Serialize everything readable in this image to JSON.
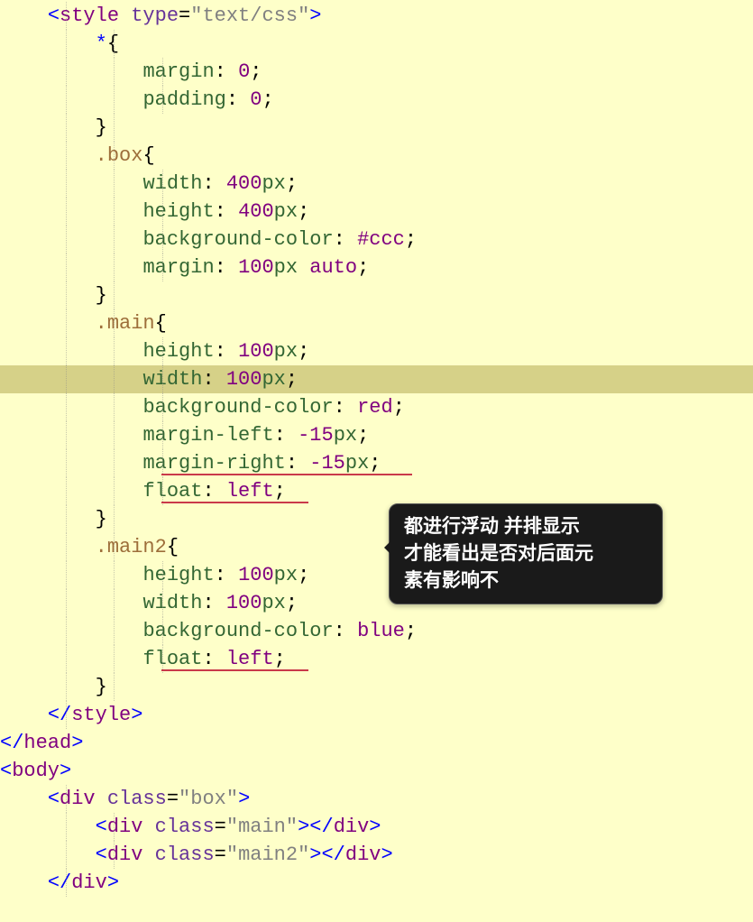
{
  "code": {
    "line1": {
      "lt": "<",
      "tag": "style",
      "sp": " ",
      "attr": "type",
      "eq": "=",
      "q1": "\"",
      "val": "text/css",
      "q2": "\"",
      "gt": ">"
    },
    "line2": {
      "sel": "*",
      "ob": "{"
    },
    "line3": {
      "prop": "margin",
      "c": ":",
      "sp": " ",
      "val": "0",
      "sc": ";"
    },
    "line4": {
      "prop": "padding",
      "c": ":",
      "sp": " ",
      "val": "0",
      "sc": ";"
    },
    "line5": {
      "cb": "}"
    },
    "line6": {
      "sel": ".box",
      "ob": "{"
    },
    "line7": {
      "prop": "width",
      "c": ":",
      "sp": " ",
      "val": "400",
      "unit": "px",
      "sc": ";"
    },
    "line8": {
      "prop": "height",
      "c": ":",
      "sp": " ",
      "val": "400",
      "unit": "px",
      "sc": ";"
    },
    "line9": {
      "prop": "background-color",
      "c": ":",
      "sp": " ",
      "val": "#ccc",
      "sc": ";"
    },
    "line10": {
      "prop": "margin",
      "c": ":",
      "sp": " ",
      "val": "100",
      "unit": "px",
      "sp2": " ",
      "val2": "auto",
      "sc": ";"
    },
    "line11": {
      "cb": "}"
    },
    "line12": {
      "sel": ".main",
      "ob": "{"
    },
    "line13": {
      "prop": "height",
      "c": ":",
      "sp": " ",
      "val": "100",
      "unit": "px",
      "sc": ";"
    },
    "line14": {
      "prop": "width",
      "c": ":",
      "sp": " ",
      "val": "100",
      "unit": "px",
      "sc": ";"
    },
    "line15": {
      "prop": "background-color",
      "c": ":",
      "sp": " ",
      "val": "red",
      "sc": ";"
    },
    "line16": {
      "prop": "margin-left",
      "c": ":",
      "sp": " ",
      "val": "-15",
      "unit": "px",
      "sc": ";"
    },
    "line17": {
      "prop": "margin-right",
      "c": ":",
      "sp": " ",
      "val": "-15",
      "unit": "px",
      "sc": ";"
    },
    "line18": {
      "prop": "float",
      "c": ":",
      "sp": " ",
      "val": "left",
      "sc": ";"
    },
    "line19": {
      "cb": "}"
    },
    "line20": {
      "sel": ".main2",
      "ob": "{"
    },
    "line21": {
      "prop": "height",
      "c": ":",
      "sp": " ",
      "val": "100",
      "unit": "px",
      "sc": ";"
    },
    "line22": {
      "prop": "width",
      "c": ":",
      "sp": " ",
      "val": "100",
      "unit": "px",
      "sc": ";"
    },
    "line23": {
      "prop": "background-color",
      "c": ":",
      "sp": " ",
      "val": "blue",
      "sc": ";"
    },
    "line24": {
      "prop": "float",
      "c": ":",
      "sp": " ",
      "val": "left",
      "sc": ";"
    },
    "line25": {
      "cb": "}"
    },
    "line26": {
      "lt": "</",
      "tag": "style",
      "gt": ">"
    },
    "line27": {
      "lt": "</",
      "tag": "head",
      "gt": ">"
    },
    "line28": {
      "lt": "<",
      "tag": "body",
      "gt": ">"
    },
    "line29": {
      "lt": "<",
      "tag": "div",
      "sp": " ",
      "attr": "class",
      "eq": "=",
      "q1": "\"",
      "val": "box",
      "q2": "\"",
      "gt": ">"
    },
    "line30": {
      "lt": "<",
      "tag": "div",
      "sp": " ",
      "attr": "class",
      "eq": "=",
      "q1": "\"",
      "val": "main",
      "q2": "\"",
      "gt1": ">",
      "lt2": "</",
      "tag2": "div",
      "gt2": ">"
    },
    "line31": {
      "lt": "<",
      "tag": "div",
      "sp": " ",
      "attr": "class",
      "eq": "=",
      "q1": "\"",
      "val": "main2",
      "q2": "\"",
      "gt1": ">",
      "lt2": "</",
      "tag2": "div",
      "gt2": ">"
    },
    "line32": {
      "lt": "</",
      "tag": "div",
      "gt": ">"
    }
  },
  "tooltip": {
    "l1": "都进行浮动 并排显示",
    "l2": "才能看出是否对后面元",
    "l3": "素有影响不"
  }
}
